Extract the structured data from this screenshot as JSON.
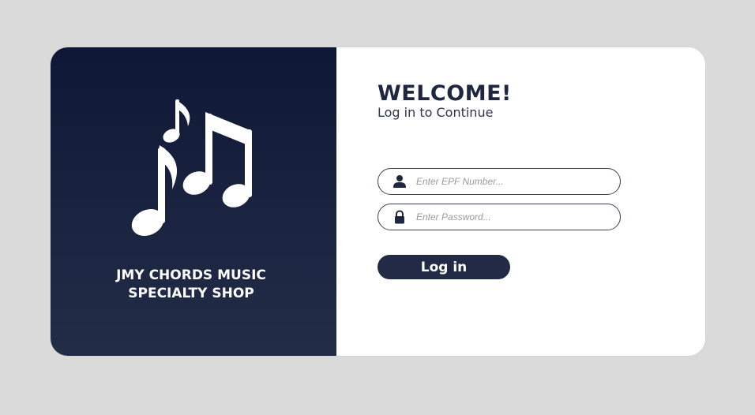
{
  "branding": {
    "shop_name": "JMY CHORDS MUSIC\nSPECIALTY SHOP",
    "logo_icon": "music-notes-icon"
  },
  "login": {
    "title": "WELCOME!",
    "subtitle": "Log in to Continue",
    "epf_placeholder": "Enter EPF Number...",
    "epf_icon": "user-icon",
    "password_placeholder": "Enter Password...",
    "password_icon": "lock-icon",
    "button_label": "Log in"
  },
  "colors": {
    "panel_dark": "#0e1836",
    "accent": "#222a45",
    "page_background": "#dadada",
    "card_background": "#ffffff"
  }
}
